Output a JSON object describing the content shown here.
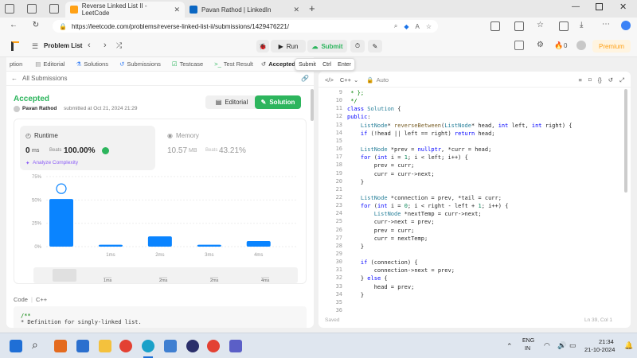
{
  "browser": {
    "tabs": [
      {
        "title": "Reverse Linked List II - LeetCode",
        "favicon_color": "#ffa116"
      },
      {
        "title": "Pavan Rathod | LinkedIn",
        "favicon_color": "#0a66c2"
      }
    ],
    "url": "https://leetcode.com/problems/reverse-linked-list-ii/submissions/1429476221/"
  },
  "lc_header": {
    "problem_list": "Problem List",
    "run": "Run",
    "submit": "Submit",
    "streak": "0",
    "premium": "Premium",
    "tooltip": {
      "label": "Submit",
      "key1": "Ctrl",
      "key2": "Enter"
    }
  },
  "left_tabs": [
    "ption",
    "Editorial",
    "Solutions",
    "Submissions",
    "Testcase",
    "Test Result",
    "Accepted"
  ],
  "submission": {
    "back_label": "All Submissions",
    "status": "Accepted",
    "user": "Pavan Rathod",
    "submitted_text": "submitted at Oct 21, 2024 21:29",
    "editorial_btn": "Editorial",
    "solution_btn": "Solution",
    "runtime_label": "Runtime",
    "runtime_value": "0",
    "runtime_unit": "ms",
    "runtime_beats_label": "Beats",
    "runtime_beats": "100.00%",
    "analyze": "Analyze Complexity",
    "memory_label": "Memory",
    "memory_value": "10.57",
    "memory_unit": "MB",
    "memory_beats_label": "Beats",
    "memory_beats": "43.21%",
    "code_label": "Code",
    "lang": "C++",
    "code_preview": [
      "/**",
      " * Definition for singly-linked list."
    ]
  },
  "chart_data": {
    "type": "bar",
    "categories": [
      "0ms",
      "1ms",
      "2ms",
      "3ms",
      "4ms"
    ],
    "values": [
      51,
      2,
      11,
      2,
      6
    ],
    "yticks": [
      "75%",
      "50%",
      "25%",
      "0%"
    ],
    "ylim": [
      0,
      75
    ],
    "x_tick_labels": [
      "1ms",
      "2ms",
      "3ms",
      "4ms"
    ],
    "minimap_labels": [
      "1ms",
      "2ms",
      "2ms",
      "4ms"
    ],
    "highlight_color": "#0a84ff",
    "bar_color": "#0a84ff"
  },
  "editor": {
    "lang": "C++",
    "mode": "Auto",
    "status_left": "Saved",
    "status_right": "Ln 39, Col 1",
    "start_line": 9,
    "lines": [
      " * };",
      " */",
      "class Solution {",
      "public:",
      "    ListNode* reverseBetween(ListNode* head, int left, int right) {",
      "    if (!head || left == right) return head;",
      "",
      "    ListNode *prev = nullptr, *curr = head;",
      "    for (int i = 1; i < left; i++) {",
      "        prev = curr;",
      "        curr = curr->next;",
      "    }",
      "",
      "    ListNode *connection = prev, *tail = curr;",
      "    for (int i = 0; i < right - left + 1; i++) {",
      "        ListNode *nextTemp = curr->next;",
      "        curr->next = prev;",
      "        prev = curr;",
      "        curr = nextTemp;",
      "    }",
      "",
      "    if (connection) {",
      "        connection->next = prev;",
      "    } else {",
      "        head = prev;",
      "    }",
      "",
      ""
    ]
  },
  "taskbar": {
    "lang1": "ENG",
    "lang2": "IN",
    "time": "21:34",
    "date": "21-10-2024"
  }
}
